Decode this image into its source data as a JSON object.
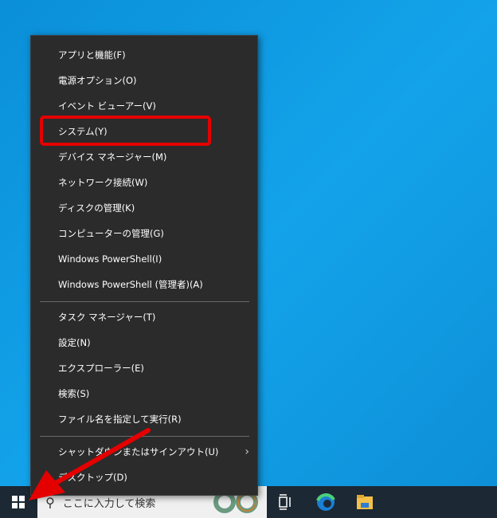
{
  "menu": {
    "items": [
      {
        "label": "アプリと機能(F)"
      },
      {
        "label": "電源オプション(O)"
      },
      {
        "label": "イベント ビューアー(V)"
      },
      {
        "label": "システム(Y)"
      },
      {
        "label": "デバイス マネージャー(M)"
      },
      {
        "label": "ネットワーク接続(W)"
      },
      {
        "label": "ディスクの管理(K)"
      },
      {
        "label": "コンピューターの管理(G)"
      },
      {
        "label": "Windows PowerShell(I)"
      },
      {
        "label": "Windows PowerShell (管理者)(A)"
      },
      {
        "label": "タスク マネージャー(T)"
      },
      {
        "label": "設定(N)"
      },
      {
        "label": "エクスプローラー(E)"
      },
      {
        "label": "検索(S)"
      },
      {
        "label": "ファイル名を指定して実行(R)"
      },
      {
        "label": "シャットダウンまたはサインアウト(U)",
        "submenu_icon": "chevron-right-icon"
      },
      {
        "label": "デスクトップ(D)"
      }
    ],
    "highlighted": "システム(Y)"
  },
  "taskbar": {
    "search_placeholder": "ここに入力して検索",
    "icons": [
      "windows-start-icon",
      "search-icon",
      "task-view-icon",
      "edge-icon",
      "file-explorer-icon"
    ]
  },
  "colors": {
    "highlight": "#e50000",
    "annotation_arrow": "#e50000",
    "menu_bg": "#2b2b2b"
  }
}
